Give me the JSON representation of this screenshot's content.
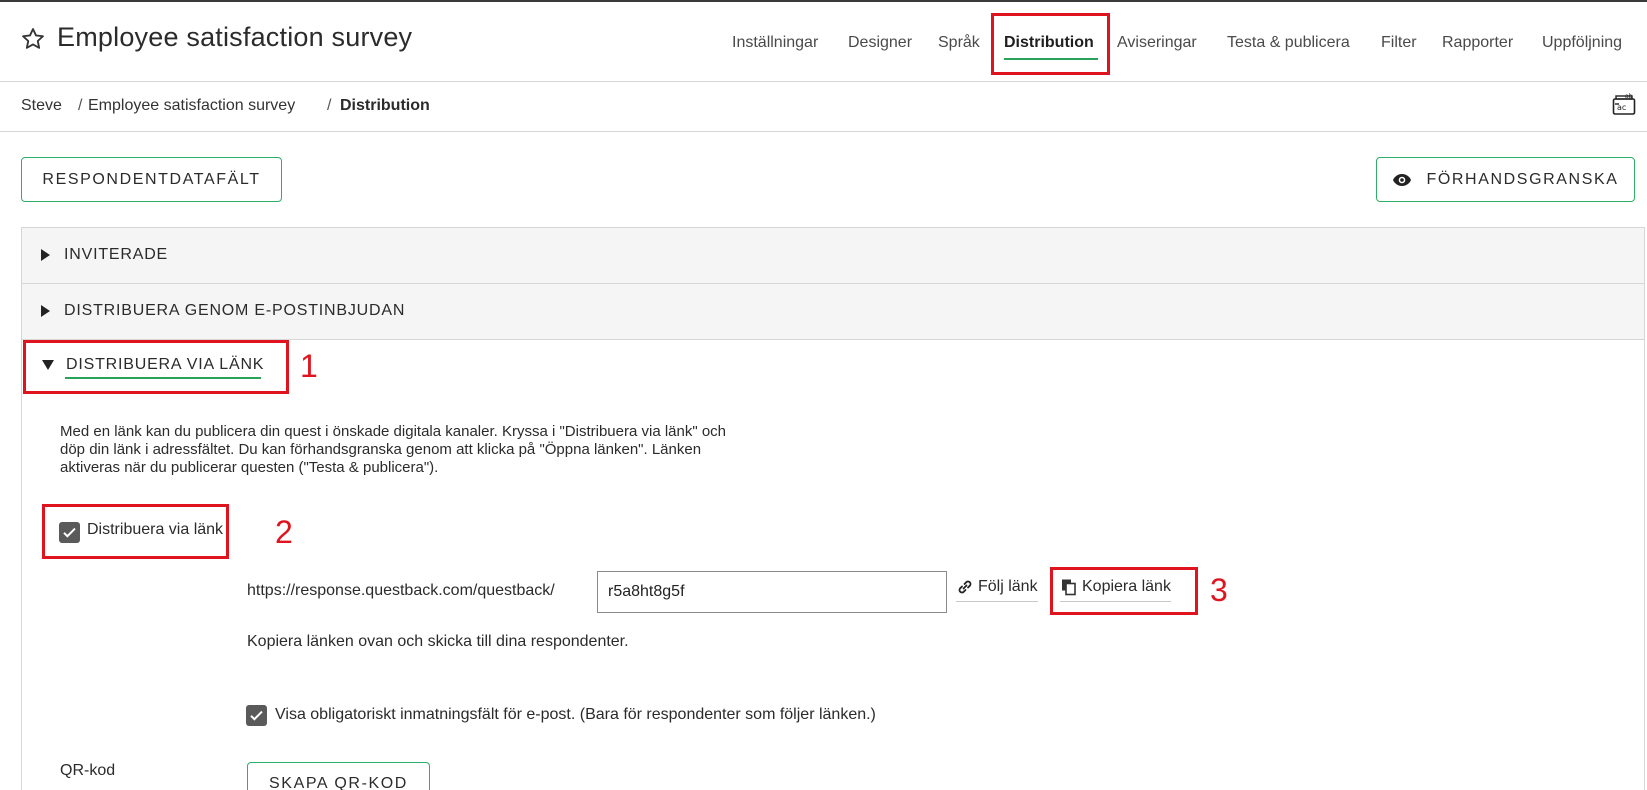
{
  "header": {
    "title": "Employee satisfaction survey",
    "nav": [
      {
        "label": "Inställningar"
      },
      {
        "label": "Designer"
      },
      {
        "label": "Språk"
      },
      {
        "label": "Distribution",
        "active": true
      },
      {
        "label": "Aviseringar"
      },
      {
        "label": "Testa & publicera"
      },
      {
        "label": "Filter"
      },
      {
        "label": "Rapporter"
      },
      {
        "label": "Uppföljning"
      }
    ]
  },
  "breadcrumb": {
    "items": [
      "Steve",
      "Employee satisfaction survey",
      "Distribution"
    ],
    "separator": "/"
  },
  "actions": {
    "respondent_fields": "RESPONDENTDATAFÄLT",
    "preview": "FÖRHANDSGRANSKA"
  },
  "accordion": {
    "invited": "INVITERADE",
    "email_invite": "DISTRIBUERA GENOM E-POSTINBJUDAN",
    "via_link": "DISTRIBUERA VIA LÄNK"
  },
  "via_link": {
    "description_lines": [
      "Med en länk kan du publicera din quest i önskade digitala kanaler. Kryssa i \"Distribuera via länk\" och",
      "döp din länk i adressfältet. Du kan förhandsgranska genom att klicka på \"Öppna länken\". Länken",
      "aktiveras när du publicerar questen (\"Testa & publicera\")."
    ],
    "checkbox_label": "Distribuera via länk",
    "checkbox_checked": true,
    "url_prefix": "https://response.questback.com/questback/",
    "url_slug": "r5a8ht8g5f",
    "follow_link": "Följ länk",
    "copy_link": "Kopiera länk",
    "hint": "Kopiera länken ovan och skicka till dina respondenter.",
    "email_checkbox_label": "Visa obligatoriskt inmatningsfält för e-post. (Bara för respondenter som följer länken.)",
    "email_checkbox_checked": true,
    "qr_label": "QR-kod",
    "qr_button": "SKAPA QR-KOD"
  },
  "annotations": {
    "marker_1": "1",
    "marker_2": "2",
    "marker_3": "3"
  },
  "colors": {
    "accent_green": "#29a35a",
    "highlight_red": "#e0141e",
    "checkbox_gray": "#5a5a5a"
  }
}
